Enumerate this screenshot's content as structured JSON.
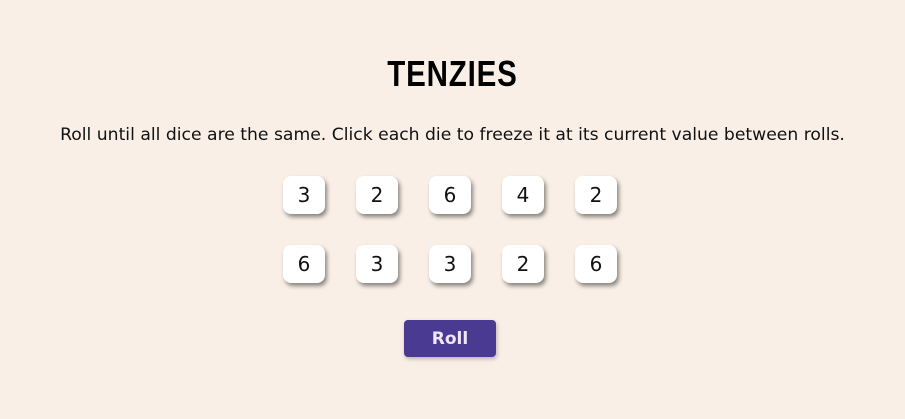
{
  "app": {
    "title": "TENZIES",
    "instructions": "Roll until all dice are the same. Click each die to freeze it at its current value between rolls."
  },
  "dice": [
    {
      "value": "3",
      "held": false
    },
    {
      "value": "2",
      "held": false
    },
    {
      "value": "6",
      "held": false
    },
    {
      "value": "4",
      "held": false
    },
    {
      "value": "2",
      "held": false
    },
    {
      "value": "6",
      "held": false
    },
    {
      "value": "3",
      "held": false
    },
    {
      "value": "3",
      "held": false
    },
    {
      "value": "2",
      "held": false
    },
    {
      "value": "6",
      "held": false
    }
  ],
  "controls": {
    "roll_label": "Roll"
  },
  "colors": {
    "background": "#f9efe6",
    "die_face": "#ffffff",
    "button": "#4b3a92",
    "button_text": "#eee8f8"
  }
}
